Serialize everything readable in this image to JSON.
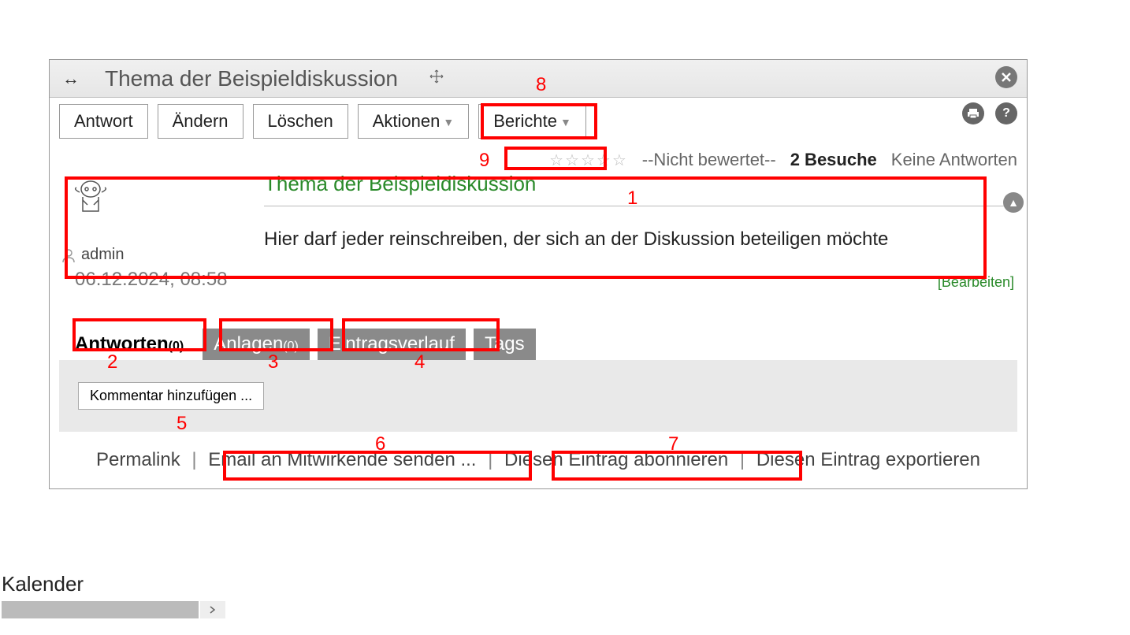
{
  "window": {
    "title": "Thema der Beispieldiskussion"
  },
  "toolbar": {
    "antwort": "Antwort",
    "aendern": "Ändern",
    "loeschen": "Löschen",
    "aktionen": "Aktionen",
    "berichte": "Berichte"
  },
  "meta": {
    "not_rated": "--Nicht bewertet--",
    "visits_prefix": "2 Besuche",
    "no_answers": "Keine Antworten"
  },
  "post": {
    "title": "Thema der Beispieldiskussion",
    "author": "admin",
    "date": "06.12.2024, 08:58",
    "body": "Hier darf jeder reinschreiben, der sich an der Diskussion beteiligen möchte",
    "edit": "[Bearbeiten]"
  },
  "tabs": {
    "antworten": "Antworten",
    "antworten_count": "(0)",
    "anlagen": "Anlagen",
    "anlagen_count": "(0)",
    "verlauf": "Eintragsverlauf",
    "tags": "Tags"
  },
  "comment": {
    "add": "Kommentar hinzufügen ..."
  },
  "footer": {
    "permalink": "Permalink",
    "email": "Email an Mitwirkende senden ...",
    "subscribe": "Diesen Eintrag abonnieren",
    "export": "Diesen Eintrag exportieren"
  },
  "sidebar": {
    "kalender": "Kalender"
  },
  "annotations": {
    "n1": "1",
    "n2": "2",
    "n3": "3",
    "n4": "4",
    "n5": "5",
    "n6": "6",
    "n7": "7",
    "n8": "8",
    "n9": "9"
  }
}
